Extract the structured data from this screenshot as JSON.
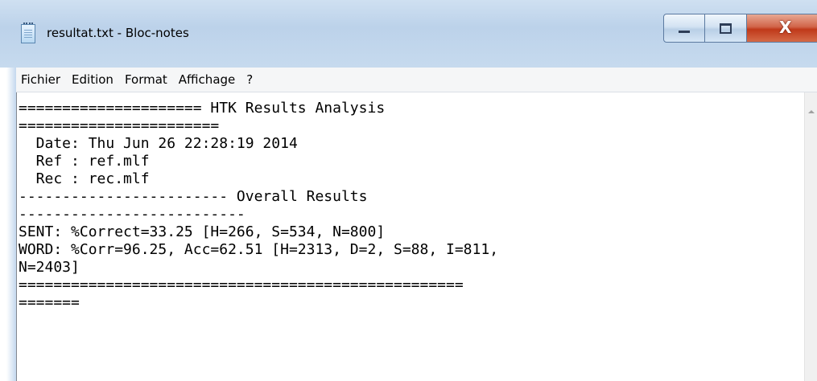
{
  "window": {
    "title": "resultat.txt - Bloc-notes",
    "app_icon": "notepad-icon",
    "caption_buttons": {
      "minimize_icon": "minimize-icon",
      "maximize_icon": "maximize-icon",
      "close_glyph": "X"
    }
  },
  "menu": {
    "items": [
      "Fichier",
      "Edition",
      "Format",
      "Affichage",
      "?"
    ]
  },
  "editor": {
    "lines": [
      "===================== HTK Results Analysis",
      "=======================",
      "  Date: Thu Jun 26 22:28:19 2014",
      "  Ref : ref.mlf",
      "  Rec : rec.mlf",
      "------------------------ Overall Results",
      "--------------------------",
      "SENT: %Correct=33.25 [H=266, S=534, N=800]",
      "WORD: %Corr=96.25, Acc=62.51 [H=2313, D=2, S=88, I=811,",
      "N=2403]",
      "===================================================",
      "======="
    ]
  },
  "colors": {
    "titlebar": "#c6daee",
    "close_button": "#c0391a",
    "menubar": "#f5f6f7",
    "editor_bg": "#ffffff"
  }
}
